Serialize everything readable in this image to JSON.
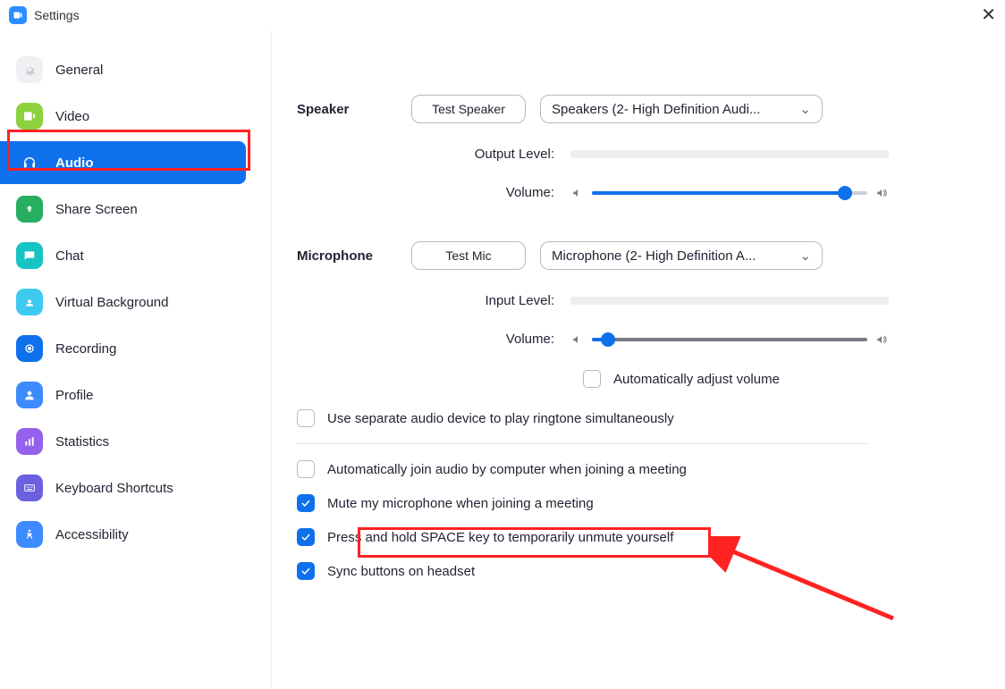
{
  "window": {
    "title": "Settings"
  },
  "sidebar": {
    "items": [
      {
        "label": "General"
      },
      {
        "label": "Video"
      },
      {
        "label": "Audio"
      },
      {
        "label": "Share Screen"
      },
      {
        "label": "Chat"
      },
      {
        "label": "Virtual Background"
      },
      {
        "label": "Recording"
      },
      {
        "label": "Profile"
      },
      {
        "label": "Statistics"
      },
      {
        "label": "Keyboard Shortcuts"
      },
      {
        "label": "Accessibility"
      }
    ]
  },
  "audio": {
    "speaker_label": "Speaker",
    "test_speaker_btn": "Test Speaker",
    "speaker_selected": "Speakers (2- High Definition Audi...",
    "output_level_label": "Output Level:",
    "speaker_volume_label": "Volume:",
    "speaker_volume_pct": 92,
    "mic_label": "Microphone",
    "test_mic_btn": "Test Mic",
    "mic_selected": "Microphone (2- High Definition A...",
    "input_level_label": "Input Level:",
    "mic_volume_label": "Volume:",
    "mic_volume_pct": 6,
    "auto_adjust_label": "Automatically adjust volume",
    "separate_audio_label": "Use separate audio device to play ringtone simultaneously",
    "auto_join_label": "Automatically join audio by computer when joining a meeting",
    "mute_on_join_label": "Mute my microphone when joining a meeting",
    "space_unmute_label": "Press and hold SPACE key to temporarily unmute yourself",
    "sync_headset_label": "Sync buttons on headset"
  }
}
